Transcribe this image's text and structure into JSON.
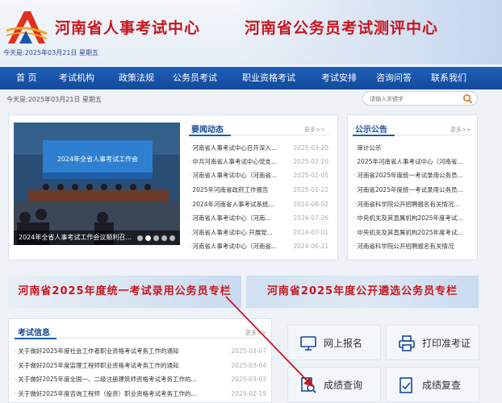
{
  "header": {
    "title_left": "河南省人事考试中心",
    "title_right": "河南省公务员考试测评中心",
    "date": "今天是:2025年03月21日 星期五"
  },
  "nav": {
    "items": [
      "首 页",
      "考试机构",
      "政策法规",
      "公务员考试",
      "职业资格考试",
      "考试安排",
      "咨询问答",
      "联系我们"
    ]
  },
  "toolbar": {
    "today": "今天是:2025年03月21日 星期五",
    "search_placeholder": "请输入关键字"
  },
  "news": {
    "photo_caption": "2024年全省人事考试工作会议顺利召...",
    "photo_banner": "2024年全省人事考试工作会",
    "title": "要闻动态",
    "more": "更多>>",
    "items": [
      {
        "text": "河南省人事考试中心召开深入...",
        "date": "2025-03-20"
      },
      {
        "text": "中共河南省人事考试中心党支...",
        "date": "2025-02-20"
      },
      {
        "text": "河南省人事考试中心（河南省...",
        "date": "2025-02-05"
      },
      {
        "text": "2025年河南省政府工作报告",
        "date": "2025-01-22"
      },
      {
        "text": "2024年河南省人事考试系统...",
        "date": "2024-08-02"
      },
      {
        "text": "河南省人事考试中心（河南...",
        "date": "2024-07-26"
      },
      {
        "text": "河南省人事考试中心 开展党...",
        "date": "2024-07-01"
      },
      {
        "text": "河南省人事考试中心（河南省...",
        "date": "2024-06-21"
      }
    ]
  },
  "notice": {
    "title": "公示公告",
    "more": "更多>>",
    "items": [
      "审计公示",
      "2025年河南省人事考试中心（河南省...",
      "河南省2025年度统一考试录用公务员...",
      "河南省2025年度统一考试录用公务员...",
      "河南省科学院公开招聘报名有关情况...",
      "中央机关及其直属机构2025年度考试...",
      "中央机关及其直属机构2025年度考试...",
      "河南省科学院公开招聘报名有关情况"
    ]
  },
  "promos": {
    "left": "河南省2025年度统一考试录用公务员专栏",
    "right": "河南省2025年度公开遴选公务员专栏"
  },
  "exam_info": {
    "title": "考试信息",
    "more": "更多>>",
    "items": [
      {
        "text": "关于做好2025年度社会工作者职业资格考试考务工作的通知",
        "date": "2025-03-07"
      },
      {
        "text": "关于做好2025年度监理工程师职业资格考试考务工作的通知",
        "date": "2025-03-04"
      },
      {
        "text": "关于做好2025年度全国一、二级注册建筑师资格考试考务工作的...",
        "date": "2025-03-03"
      },
      {
        "text": "关于做好2025年度咨询工程师（投资）职业资格考试考务工作的...",
        "date": "2025-02-19"
      }
    ]
  },
  "quick": {
    "register": "网上报名",
    "print_ticket": "打印准考证",
    "score_query": "成绩查询",
    "score_review": "成绩复查"
  },
  "colors": {
    "brand_red": "#c8161d",
    "nav_blue": "#1a55ad",
    "heading_blue": "#1a4a96"
  }
}
